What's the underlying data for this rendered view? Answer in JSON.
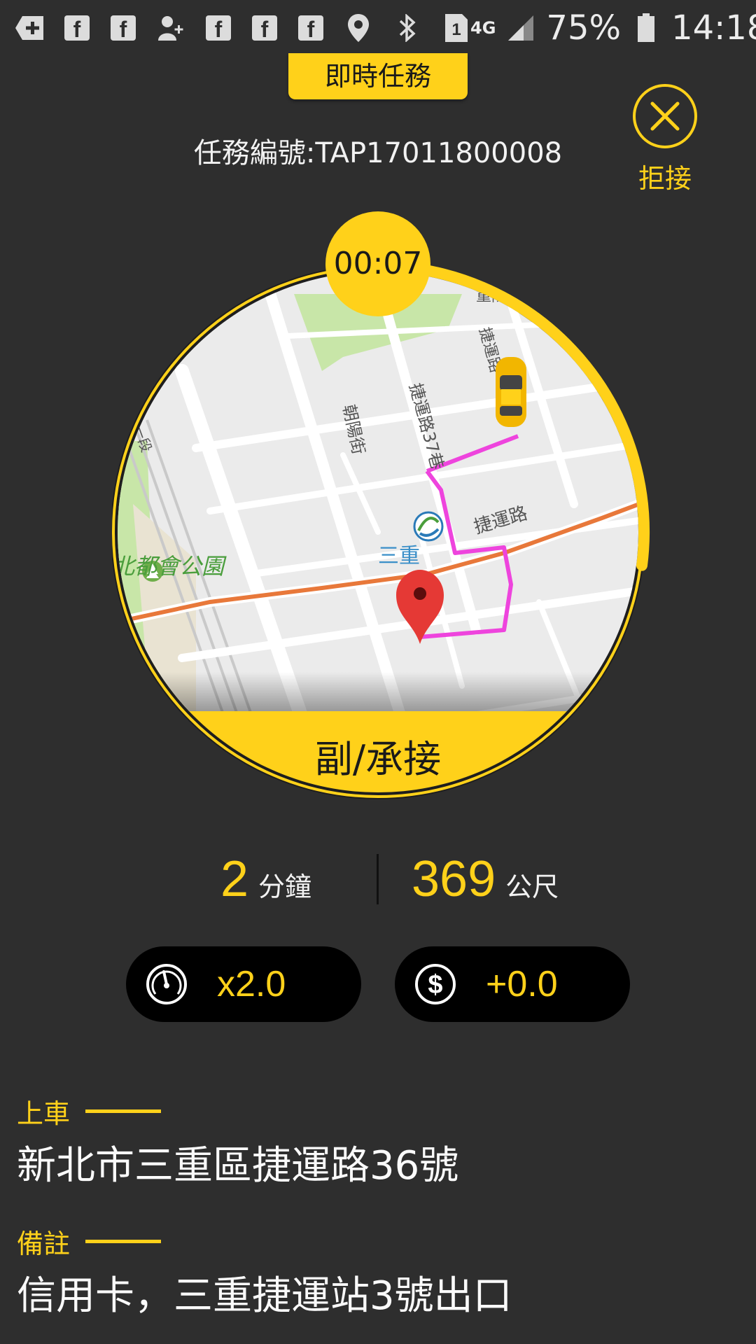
{
  "status_bar": {
    "battery": "75%",
    "time": "14:18",
    "network": "4G",
    "sim": "1",
    "icons": [
      "add-icon",
      "facebook-icon",
      "facebook-icon",
      "add-contact-icon",
      "facebook-icon",
      "facebook-icon",
      "facebook-icon",
      "location-icon",
      "bluetooth-icon",
      "sim-icon",
      "signal-icon",
      "battery-icon"
    ]
  },
  "header": {
    "task_type": "即時任務",
    "task_number": "任務編號:TAP17011800008",
    "reject_label": "拒接"
  },
  "map": {
    "timer": "00:07",
    "accept_label": "副/承接",
    "labels": {
      "park": "北都會公園",
      "station": "三重",
      "street_chaoyang": "朝陽街",
      "street_lane37": "捷運路37巷",
      "street_jieyun": "捷運路",
      "street_jieyun_top": "捷運路",
      "street_chongyang": "重陽",
      "section": "一段"
    },
    "countdown_progress": 0.27,
    "colors": {
      "accent": "#ffd11a",
      "route": "#ee44dd",
      "road_main": "#e8783a",
      "park": "#c8e6a8"
    }
  },
  "stats": {
    "minutes_value": "2",
    "minutes_unit": "分鐘",
    "meters_value": "369",
    "meters_unit": "公尺"
  },
  "pills": {
    "multiplier": "x2.0",
    "tip": "+0.0",
    "multiplier_icon": "speedometer-icon",
    "tip_icon": "dollar-icon"
  },
  "pickup": {
    "label": "上車",
    "address": "新北市三重區捷運路36號"
  },
  "note": {
    "label": "備註",
    "text": "信用卡，三重捷運站3號出口"
  }
}
